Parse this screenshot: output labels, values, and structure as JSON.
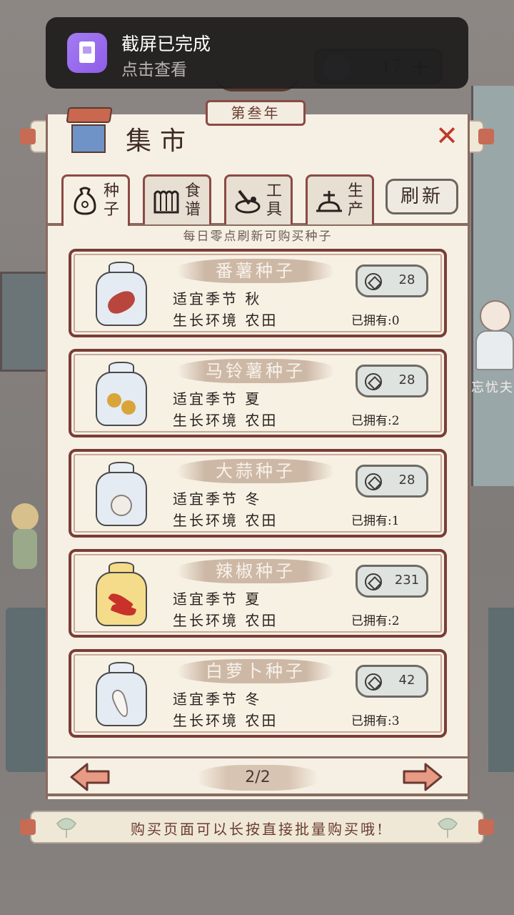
{
  "notification": {
    "title": "截屏已完成",
    "subtitle": "点击查看"
  },
  "top_status": {
    "value": "17",
    "plus": "+"
  },
  "year_label": "第叁年",
  "background_character_name": "忘忧夫",
  "panel": {
    "title": "集市",
    "close_label": "✕"
  },
  "tabs": [
    {
      "label": "种子",
      "icon": "seed-bag-icon",
      "active": true
    },
    {
      "label": "食谱",
      "icon": "recipe-icon",
      "active": false
    },
    {
      "label": "工具",
      "icon": "tool-icon",
      "active": false
    },
    {
      "label": "生产",
      "icon": "production-icon",
      "active": false
    }
  ],
  "refresh_label": "刷新",
  "hint": "每日零点刷新可购买种子",
  "items": [
    {
      "name": "番薯种子",
      "season": "适宜季节 秋",
      "env": "生长环境 农田",
      "price": "28",
      "owned": "已拥有:0",
      "icon": "sweet-potato-icon",
      "bag_color": "blue"
    },
    {
      "name": "马铃薯种子",
      "season": "适宜季节 夏",
      "env": "生长环境 农田",
      "price": "28",
      "owned": "已拥有:2",
      "icon": "potato-icon",
      "bag_color": "blue"
    },
    {
      "name": "大蒜种子",
      "season": "适宜季节 冬",
      "env": "生长环境 农田",
      "price": "28",
      "owned": "已拥有:1",
      "icon": "garlic-icon",
      "bag_color": "blue"
    },
    {
      "name": "辣椒种子",
      "season": "适宜季节 夏",
      "env": "生长环境 农田",
      "price": "231",
      "owned": "已拥有:2",
      "icon": "chili-icon",
      "bag_color": "yellow"
    },
    {
      "name": "白萝卜种子",
      "season": "适宜季节 冬",
      "env": "生长环境 农田",
      "price": "42",
      "owned": "已拥有:3",
      "icon": "radish-icon",
      "bag_color": "blue"
    }
  ],
  "pagination": {
    "page": "2/2"
  },
  "footer_tip": "购买页面可以长按直接批量购买哦!",
  "colors": {
    "accent": "#8b4a44",
    "close": "#c0392b",
    "panel_bg": "#f6f0e4"
  }
}
